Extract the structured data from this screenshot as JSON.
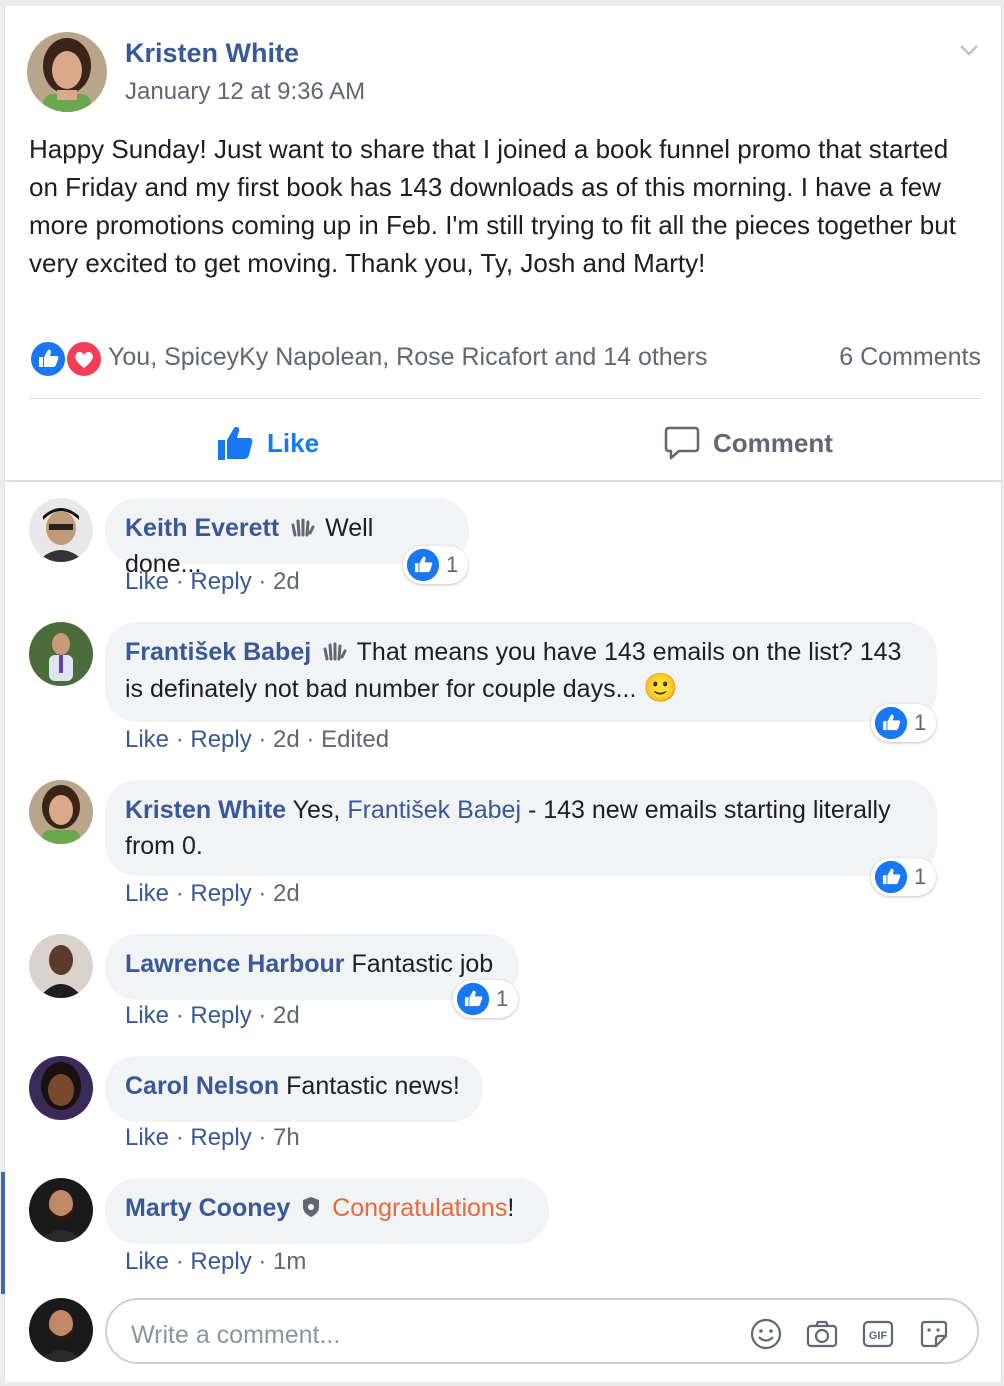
{
  "post": {
    "author": "Kristen White",
    "timestamp": "January 12 at 9:36 AM",
    "body": "Happy Sunday! Just want to share that I joined a book funnel promo that started on Friday and my first book has 143 downloads as of this morning. I have a few more promotions coming up in Feb. I'm still trying to fit all the pieces together but very excited to get moving. Thank you, Ty, Josh and Marty!",
    "reactions_text": "You, SpiceyKy Napolean, Rose Ricafort and 14 others",
    "comments_count": "6 Comments"
  },
  "actions": {
    "like": "Like",
    "comment": "Comment"
  },
  "comments": [
    {
      "name": "Keith Everett",
      "text": "Well done...",
      "like": "Like",
      "reply": "Reply",
      "time": "2d",
      "likes": "1"
    },
    {
      "name": "František Babej",
      "text": "That means you have 143 emails on the list? 143 is definately not bad number for couple days...",
      "emoji": "🙂",
      "like": "Like",
      "reply": "Reply",
      "time": "2d",
      "edited": "Edited",
      "likes": "1"
    },
    {
      "name": "Kristen White",
      "text_pre": "Yes,",
      "mention": "František Babej",
      "text_post": "- 143 new emails starting literally from 0.",
      "like": "Like",
      "reply": "Reply",
      "time": "2d",
      "likes": "1"
    },
    {
      "name": "Lawrence Harbour",
      "text": "Fantastic job",
      "like": "Like",
      "reply": "Reply",
      "time": "2d",
      "likes": "1"
    },
    {
      "name": "Carol Nelson",
      "text": "Fantastic news!",
      "like": "Like",
      "reply": "Reply",
      "time": "7h"
    },
    {
      "name": "Marty Cooney",
      "text_orange": "Congratulations",
      "text_post": "!",
      "like": "Like",
      "reply": "Reply",
      "time": "1m"
    }
  ],
  "composer": {
    "placeholder": "Write a comment..."
  },
  "colors": {
    "link": "#385898",
    "like_blue": "#1877f2",
    "love_red": "#f33e58",
    "highlight_orange": "#e66a3c"
  }
}
